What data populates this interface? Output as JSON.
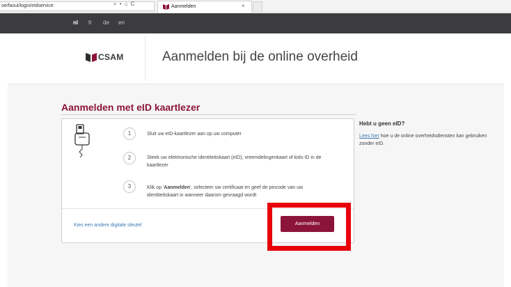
{
  "browser": {
    "url": "oe/fasui/login/eidservice",
    "url_tools": "⌕ • ⌂ C",
    "tab_title": "Aanmelden",
    "tab_close": "×"
  },
  "languages": [
    {
      "code": "nl",
      "active": true
    },
    {
      "code": "fr",
      "active": false
    },
    {
      "code": "de",
      "active": false
    },
    {
      "code": "en",
      "active": false
    }
  ],
  "header": {
    "logo_text": "CSAM",
    "title": "Aanmelden bij de online overheid"
  },
  "main": {
    "section_title": "Aanmelden met eID kaartlezer",
    "steps": [
      {
        "number": "1",
        "text": "Sluit uw eID-kaartlezer aan op uw computer"
      },
      {
        "number": "2",
        "text": "Steek uw elektronische identiteitskaart (eID), vreemdelingenkaart of kids-ID in de kaartlezer"
      },
      {
        "number": "3",
        "text_before": "Klik op '",
        "text_bold": "Aanmelden",
        "text_after": "', selecteer uw certificaat en geef de pincode van uw identiteitskaart in wanneer daarom gevraagd wordt"
      }
    ],
    "alt_key_link": "Kies een andere digitale sleutel",
    "login_button": "Aanmelden"
  },
  "sidebar": {
    "heading": "Hebt u geen eID?",
    "link_text": "Lees hier",
    "text": " hoe u de online overheidsdiensten kan gebruiken zonder eID."
  },
  "colors": {
    "brand": "#8b1538",
    "language_bar": "#3c3c3f",
    "highlight": "#e8000a",
    "link": "#3a7ab3"
  }
}
